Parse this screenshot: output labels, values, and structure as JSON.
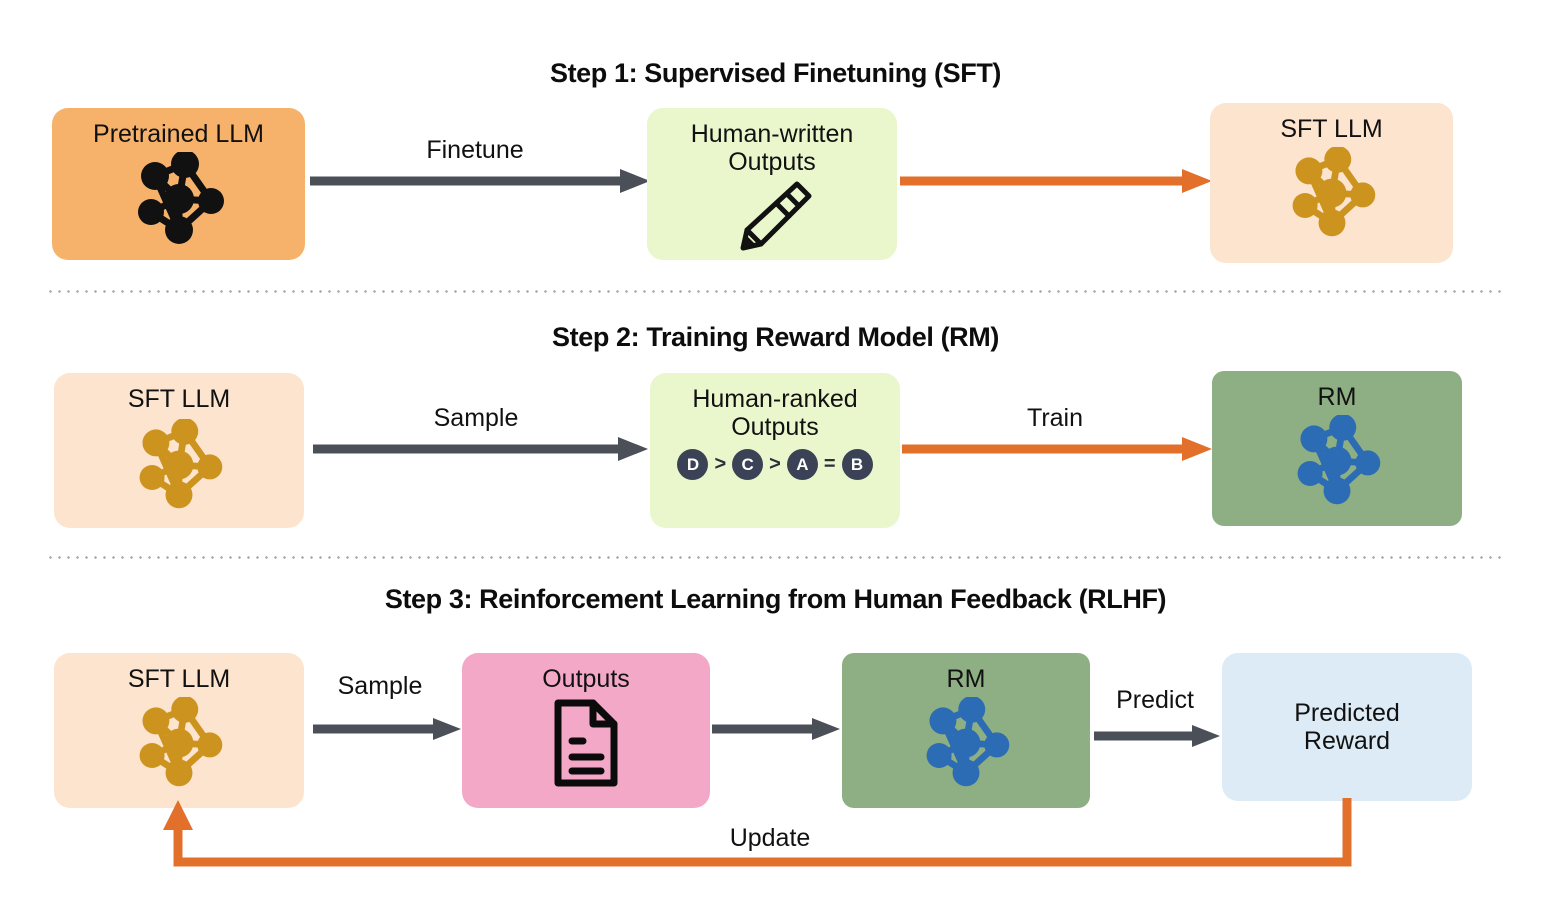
{
  "diagram": {
    "title_hidden": "RLHF three step pipeline",
    "colors": {
      "orange_solid": "#F6B26B",
      "orange_light": "#FCE4CE",
      "green_light": "#EAF7CD",
      "green_dark": "#8EAE84",
      "pink": "#F4A8C8",
      "blue_light": "#DCEBF5",
      "arrow_gray": "#4A4F58",
      "arrow_orange": "#E2702B",
      "node_black": "#111111",
      "node_gold": "#CC931F",
      "node_blue": "#2B6CB4",
      "badge_navy": "#3B4256",
      "divider_gray": "#A9A9A9"
    }
  },
  "steps": [
    {
      "title": "Step 1: Supervised Finetuning (SFT)",
      "boxes": [
        {
          "label": "Pretrained LLM",
          "icon": "neural-network-icon"
        },
        {
          "label": "Human-written\nOutputs",
          "icon": "pencil-icon"
        },
        {
          "label": "SFT LLM",
          "icon": "neural-network-icon"
        }
      ],
      "arrows": [
        {
          "label": "Finetune",
          "color": "gray"
        },
        {
          "label": "",
          "color": "orange"
        }
      ]
    },
    {
      "title": "Step 2: Training Reward Model (RM)",
      "boxes": [
        {
          "label": "SFT LLM",
          "icon": "neural-network-icon"
        },
        {
          "label": "Human-ranked\nOutputs",
          "icon": "ranking-badges"
        },
        {
          "label": "RM",
          "icon": "neural-network-icon"
        }
      ],
      "arrows": [
        {
          "label": "Sample",
          "color": "gray"
        },
        {
          "label": "Train",
          "color": "orange"
        }
      ],
      "ranking": [
        "D",
        ">",
        "C",
        ">",
        "A",
        "=",
        "B"
      ]
    },
    {
      "title": "Step 3: Reinforcement Learning from Human Feedback (RLHF)",
      "boxes": [
        {
          "label": "SFT LLM",
          "icon": "neural-network-icon"
        },
        {
          "label": "Outputs",
          "icon": "document-icon"
        },
        {
          "label": "RM",
          "icon": "neural-network-icon"
        },
        {
          "label": "Predicted\nReward",
          "icon": "none"
        }
      ],
      "arrows": [
        {
          "label": "Sample",
          "color": "gray"
        },
        {
          "label": "",
          "color": "gray"
        },
        {
          "label": "Predict",
          "color": "gray"
        },
        {
          "label": "Update",
          "color": "orange"
        }
      ]
    }
  ]
}
